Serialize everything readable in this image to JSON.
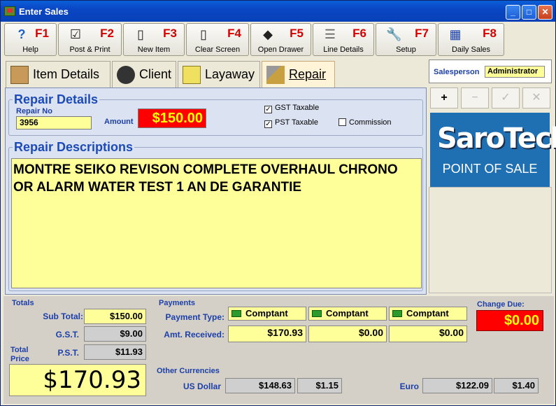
{
  "window": {
    "title": "Enter Sales",
    "min": "_",
    "max": "□",
    "close": "✕"
  },
  "toolbar": [
    {
      "key": "F1",
      "label": "Help",
      "icon": "?"
    },
    {
      "key": "F2",
      "label": "Post & Print",
      "icon": "☑"
    },
    {
      "key": "F3",
      "label": "New Item",
      "icon": "▯"
    },
    {
      "key": "F4",
      "label": "Clear Screen",
      "icon": "▯"
    },
    {
      "key": "F5",
      "label": "Open Drawer",
      "icon": "◆"
    },
    {
      "key": "F6",
      "label": "Line Details",
      "icon": "☰"
    },
    {
      "key": "F7",
      "label": "Setup",
      "icon": "🔧"
    },
    {
      "key": "F8",
      "label": "Daily Sales",
      "icon": "▦"
    }
  ],
  "tabs": [
    {
      "label": "Item Details",
      "active": false
    },
    {
      "label": "Client",
      "active": false
    },
    {
      "label": "Layaway",
      "active": false
    },
    {
      "label": "Repair",
      "active": true
    }
  ],
  "repair": {
    "section_title": "Repair Details",
    "repair_no_label": "Repair No",
    "repair_no": "3956",
    "amount_label": "Amount",
    "amount": "$150.00",
    "gst_label": "GST Taxable",
    "gst_checked": "✓",
    "pst_label": "PST Taxable",
    "pst_checked": "✓",
    "commission_label": "Commission",
    "commission_checked": "",
    "desc_title": "Repair Descriptions",
    "description": "MONTRE SEIKO REVISON COMPLETE OVERHAUL CHRONO OR ALARM WATER TEST 1 AN DE GARANTIE"
  },
  "side": {
    "salesperson_label": "Salesperson",
    "salesperson": "Administrator",
    "buttons": [
      "+",
      "−",
      "✓",
      "✕"
    ],
    "logo_brand": "SaroTech",
    "logo_sub": "POINT OF SALE"
  },
  "totals": {
    "title": "Totals",
    "subtotal_label": "Sub Total:",
    "subtotal": "$150.00",
    "gst_label": "G.S.T.",
    "gst": "$9.00",
    "pst_label": "P.S.T.",
    "pst": "$11.93",
    "total_label": "Total Price",
    "total": "$170.93"
  },
  "payments": {
    "title": "Payments",
    "type_label": "Payment Type:",
    "received_label": "Amt. Received:",
    "types": [
      "Comptant",
      "Comptant",
      "Comptant"
    ],
    "amounts": [
      "$170.93",
      "$0.00",
      "$0.00"
    ]
  },
  "change": {
    "label": "Change Due:",
    "value": "$0.00"
  },
  "currencies": {
    "title": "Other Currencies",
    "usd_label": "US Dollar",
    "usd_value": "$148.63",
    "usd_rate": "$1.15",
    "euro_label": "Euro",
    "euro_value": "$122.09",
    "euro_rate": "$1.40"
  },
  "colors": {
    "accent_blue": "#1c3fa8",
    "field_yellow": "#ffff99",
    "alert_red": "#ff0000"
  }
}
